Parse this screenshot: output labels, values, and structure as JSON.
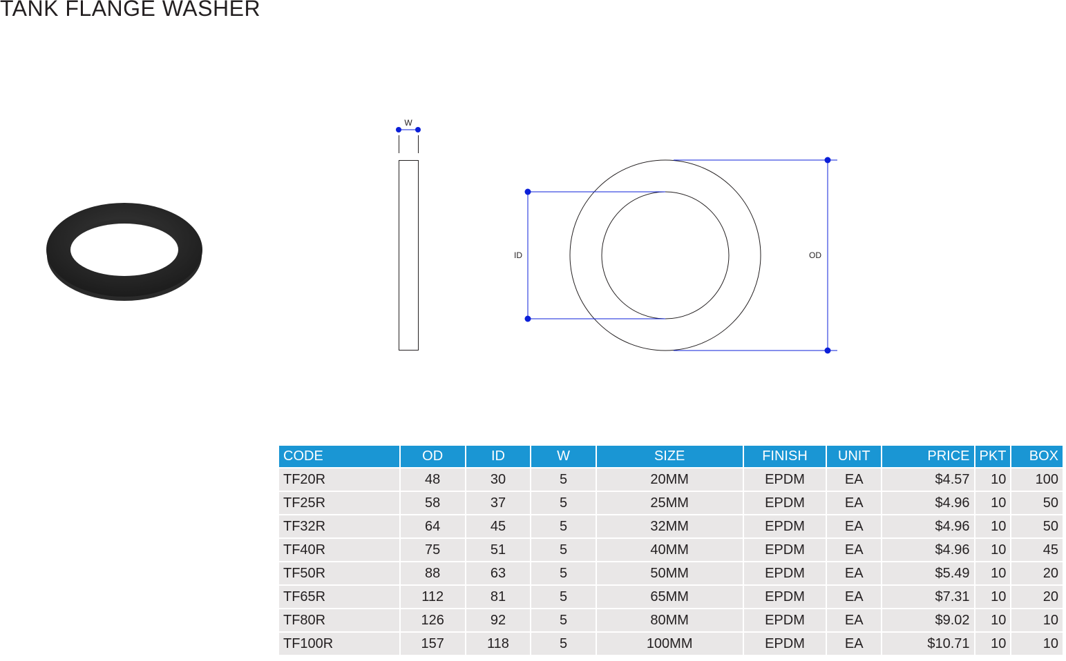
{
  "title": "TANK FLANGE WASHER",
  "drawing": {
    "w_label": "W",
    "id_label": "ID",
    "od_label": "OD"
  },
  "colors": {
    "header_bg": "#1a96d4",
    "row_bg": "#e9e7e7",
    "dimension_line": "#0b1fd8"
  },
  "table": {
    "headers": {
      "code": "CODE",
      "od": "OD",
      "id": "ID",
      "w": "W",
      "size": "SIZE",
      "finish": "FINISH",
      "unit": "UNIT",
      "price": "PRICE",
      "pkt": "PKT",
      "box": "BOX"
    },
    "rows": [
      {
        "code": "TF20R",
        "od": "48",
        "id": "30",
        "w": "5",
        "size": "20MM",
        "finish": "EPDM",
        "unit": "EA",
        "price": "$4.57",
        "pkt": "10",
        "box": "100"
      },
      {
        "code": "TF25R",
        "od": "58",
        "id": "37",
        "w": "5",
        "size": "25MM",
        "finish": "EPDM",
        "unit": "EA",
        "price": "$4.96",
        "pkt": "10",
        "box": "50"
      },
      {
        "code": "TF32R",
        "od": "64",
        "id": "45",
        "w": "5",
        "size": "32MM",
        "finish": "EPDM",
        "unit": "EA",
        "price": "$4.96",
        "pkt": "10",
        "box": "50"
      },
      {
        "code": "TF40R",
        "od": "75",
        "id": "51",
        "w": "5",
        "size": "40MM",
        "finish": "EPDM",
        "unit": "EA",
        "price": "$4.96",
        "pkt": "10",
        "box": "45"
      },
      {
        "code": "TF50R",
        "od": "88",
        "id": "63",
        "w": "5",
        "size": "50MM",
        "finish": "EPDM",
        "unit": "EA",
        "price": "$5.49",
        "pkt": "10",
        "box": "20"
      },
      {
        "code": "TF65R",
        "od": "112",
        "id": "81",
        "w": "5",
        "size": "65MM",
        "finish": "EPDM",
        "unit": "EA",
        "price": "$7.31",
        "pkt": "10",
        "box": "20"
      },
      {
        "code": "TF80R",
        "od": "126",
        "id": "92",
        "w": "5",
        "size": "80MM",
        "finish": "EPDM",
        "unit": "EA",
        "price": "$9.02",
        "pkt": "10",
        "box": "10"
      },
      {
        "code": "TF100R",
        "od": "157",
        "id": "118",
        "w": "5",
        "size": "100MM",
        "finish": "EPDM",
        "unit": "EA",
        "price": "$10.71",
        "pkt": "10",
        "box": "10"
      }
    ]
  }
}
